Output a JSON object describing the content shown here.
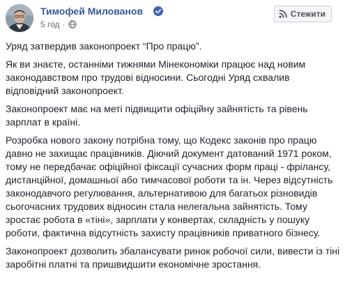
{
  "author": {
    "name": "Тимофей Милованов",
    "verified_icon": "verified-badge-icon",
    "time": "5 год",
    "privacy_icon": "globe-icon"
  },
  "follow_button": {
    "label": "Стежити",
    "icon": "rss-icon"
  },
  "colors": {
    "author_link": "#385898",
    "verified": "#4267b2",
    "text": "#1d2129",
    "meta": "#616770"
  },
  "post": {
    "paragraphs": [
      "Уряд затвердив законопроект “Про працю”.",
      "Як ви знаєте, останніми тижнями Мінекономіки працює над новим законодавством про трудові відносини. Сьогодні Уряд схвалив відповідний законопроект.",
      "Законопроект має на меті підвищити офіційну зайнятість та рівень зарплат в країні.",
      "Розробка нового закону потрібна тому, що Кодекс законів про працю давно не захищає працівників. Діючий документ датований 1971 роком, тому не передбачає офіційної фіксації сучасних форм праці - фрілансу, дистанційної, домашньої або тимчасової роботи та ін. Через відсутність законодавчого регулювання, альтернативою для багатьох різновидів сьогочасних трудових відносин стала нелегальна зайнятість. Тому зростає робота в «тіні», зарплати у конвертах, складність у пошуку роботи, фактична відсутність захисту працівників приватного бізнесу.",
      "Законопроект дозволить збалансувати ринок робочої сили, вивести із тіні заробітні платні та пришвидшити економічне зростання."
    ]
  }
}
